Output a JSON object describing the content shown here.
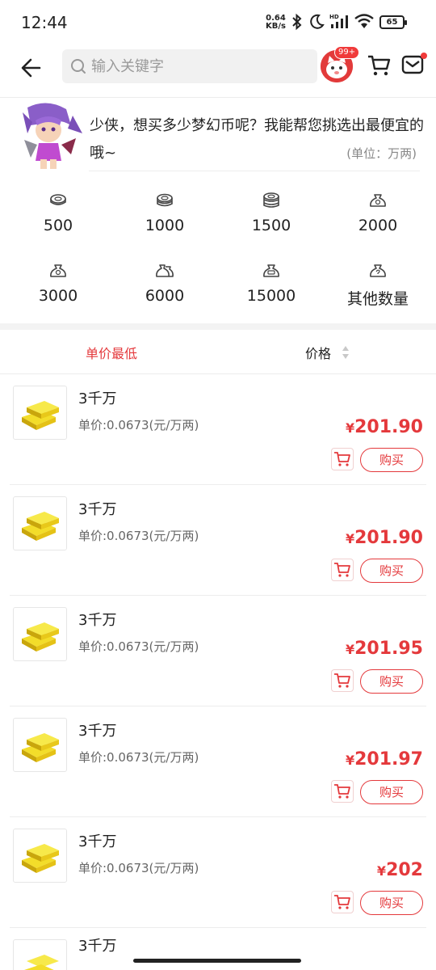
{
  "status": {
    "time": "12:44",
    "net_speed": "0.64",
    "net_unit": "KB/s",
    "hd": "HD",
    "battery": "65"
  },
  "header": {
    "search_placeholder": "输入关键字",
    "badge": "99+"
  },
  "intro": {
    "text": "少侠，想买多少梦幻币呢？我能帮您挑选出最便宜的哦~",
    "unit": "(单位：万两)"
  },
  "amounts": [
    "500",
    "1000",
    "1500",
    "2000",
    "3000",
    "6000",
    "15000",
    "其他数量"
  ],
  "sort": {
    "lowest": "单价最低",
    "price": "价格"
  },
  "items": [
    {
      "title": "3千万",
      "unit_price": "单价:0.0673(元/万两)",
      "currency": "¥",
      "price": "201.90",
      "buy": "购买"
    },
    {
      "title": "3千万",
      "unit_price": "单价:0.0673(元/万两)",
      "currency": "¥",
      "price": "201.90",
      "buy": "购买"
    },
    {
      "title": "3千万",
      "unit_price": "单价:0.0673(元/万两)",
      "currency": "¥",
      "price": "201.95",
      "buy": "购买"
    },
    {
      "title": "3千万",
      "unit_price": "单价:0.0673(元/万两)",
      "currency": "¥",
      "price": "201.97",
      "buy": "购买"
    },
    {
      "title": "3千万",
      "unit_price": "单价:0.0673(元/万两)",
      "currency": "¥",
      "price": "202",
      "buy": "购买"
    },
    {
      "title": "3千万"
    }
  ],
  "colors": {
    "accent": "#e4393c",
    "gold": "#f2d21b"
  }
}
